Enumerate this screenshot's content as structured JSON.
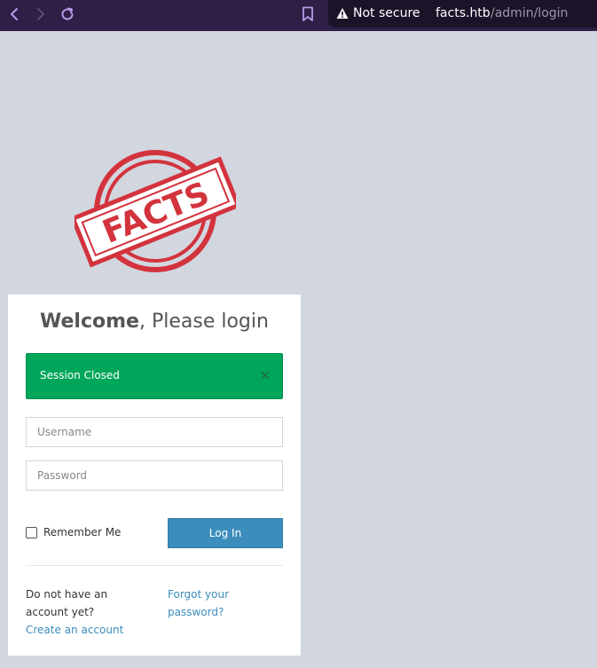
{
  "browser": {
    "security_label": "Not secure",
    "url_host": "facts.htb",
    "url_path": "/admin/login"
  },
  "logo": {
    "text": "FACTS",
    "color": "#d3333d"
  },
  "login": {
    "title_bold": "Welcome",
    "title_rest": ", Please login",
    "alert_text": "Session Closed",
    "alert_close": "×",
    "username_placeholder": "Username",
    "password_placeholder": "Password",
    "remember_label": "Remember Me",
    "login_button": "Log In",
    "no_account_text": "Do not have an account yet?",
    "create_account_link": "Create an account",
    "forgot_password_link": "Forgot your password?"
  },
  "colors": {
    "toolbar_bg": "#2f1f47",
    "page_bg": "#d2d6df",
    "alert_bg": "#00a65a",
    "button_bg": "#3c8dbc"
  }
}
